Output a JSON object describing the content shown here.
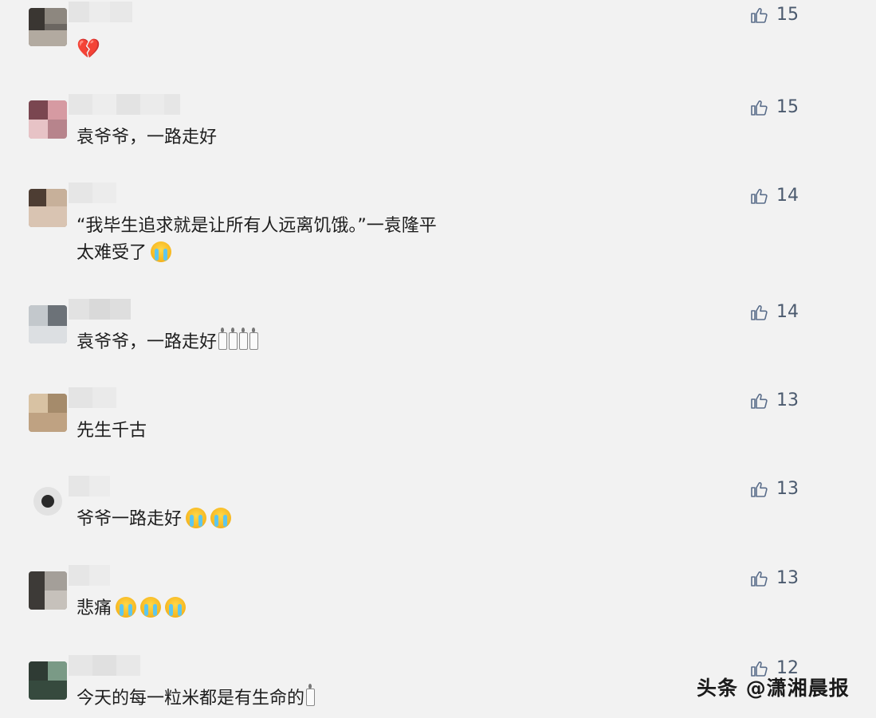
{
  "comments": [
    {
      "text": "",
      "likes": "15"
    },
    {
      "text": "袁爷爷，一路走好",
      "likes": "15"
    },
    {
      "text": "“我毕生追求就是让所有人远离饥饿。”一袁隆平",
      "text2": "太难受了",
      "likes": "14"
    },
    {
      "text": "袁爷爷，一路走好",
      "likes": "14"
    },
    {
      "text": "先生千古",
      "likes": "13"
    },
    {
      "text": "爷爷一路走好",
      "likes": "13"
    },
    {
      "text": "悲痛",
      "likes": "13"
    },
    {
      "text": "今天的每一粒米都是有生命的",
      "likes": "12"
    }
  ],
  "watermark": "头条 @潇湘晨报",
  "icons": {
    "like": "thumbs-up-icon",
    "cry": "crying-face-emoji",
    "heart": "broken-heart-emoji",
    "candle": "candle-emoji"
  },
  "colors": {
    "background": "#f2f2f2",
    "like_count": "#4b5a6e",
    "text": "#1e1e1e"
  }
}
